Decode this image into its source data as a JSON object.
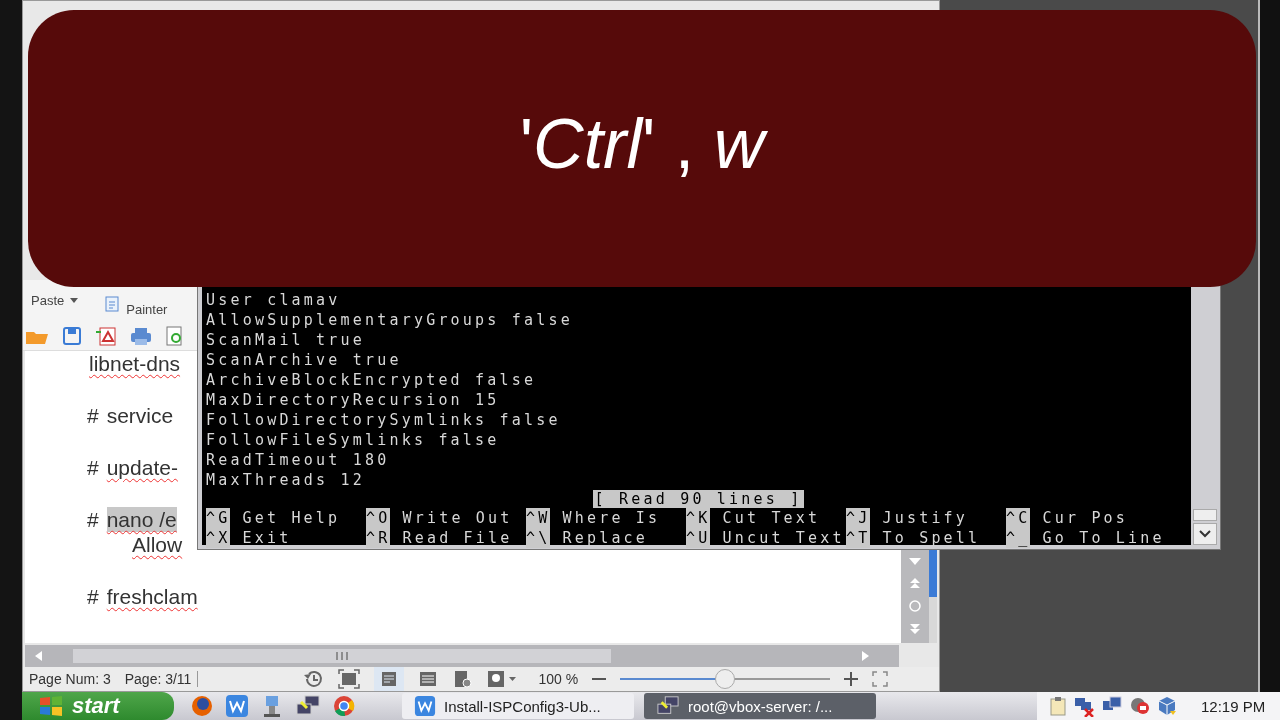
{
  "caption": {
    "text": "'*Ctrl*' , *w*"
  },
  "writer": {
    "ribbon": {
      "paste": "Paste",
      "format_painter": "Painter"
    },
    "document": [
      {
        "kind": "text",
        "text": "libnet-dns",
        "misspelled": true,
        "highlighted": false
      },
      {
        "kind": "command",
        "prefix": "#",
        "text": "service",
        "misspelled": false,
        "highlighted": false
      },
      {
        "kind": "command",
        "prefix": "#",
        "text": "update-",
        "misspelled": true,
        "highlighted": false
      },
      {
        "kind": "command",
        "prefix": "#",
        "text": "nano /e",
        "misspelled": true,
        "highlighted": true
      },
      {
        "kind": "continuation",
        "text": "Allow",
        "misspelled": true,
        "highlighted": false
      },
      {
        "kind": "command",
        "prefix": "#",
        "text": "freshclam",
        "misspelled": true,
        "highlighted": false
      }
    ],
    "status_bar": {
      "page_num": "Page Num: 3",
      "page": "Page: 3/11",
      "zoom": "100 %",
      "zoom_slider": {
        "level": 0.5
      }
    }
  },
  "terminal": {
    "lines": [
      "User clamav",
      "AllowSupplementaryGroups false",
      "ScanMail true",
      "ScanArchive true",
      "ArchiveBlockEncrypted false",
      "MaxDirectoryRecursion 15",
      "FollowDirectorySymlinks false",
      "FollowFileSymlinks false",
      "ReadTimeout 180",
      "MaxThreads 12"
    ],
    "message": "[ Read 90 lines ]",
    "shortcuts": [
      {
        "key": "^G",
        "label": "Get Help"
      },
      {
        "key": "^O",
        "label": "Write Out"
      },
      {
        "key": "^W",
        "label": "Where Is"
      },
      {
        "key": "^K",
        "label": "Cut Text"
      },
      {
        "key": "^J",
        "label": "Justify"
      },
      {
        "key": "^C",
        "label": "Cur Pos"
      },
      {
        "key": "^X",
        "label": "Exit"
      },
      {
        "key": "^R",
        "label": "Read File"
      },
      {
        "key": "^\\",
        "label": "Replace"
      },
      {
        "key": "^U",
        "label": "Uncut Text"
      },
      {
        "key": "^T",
        "label": "To Spell"
      },
      {
        "key": "^_",
        "label": "Go To Line"
      }
    ]
  },
  "taskbar": {
    "start": "start",
    "tasks": [
      {
        "label": "Install-ISPConfig3-Ub...",
        "kind": "writer",
        "selected": false
      },
      {
        "label": "root@vbox-server: /...",
        "kind": "terminal",
        "selected": true
      }
    ],
    "clock": "12:19 PM"
  }
}
